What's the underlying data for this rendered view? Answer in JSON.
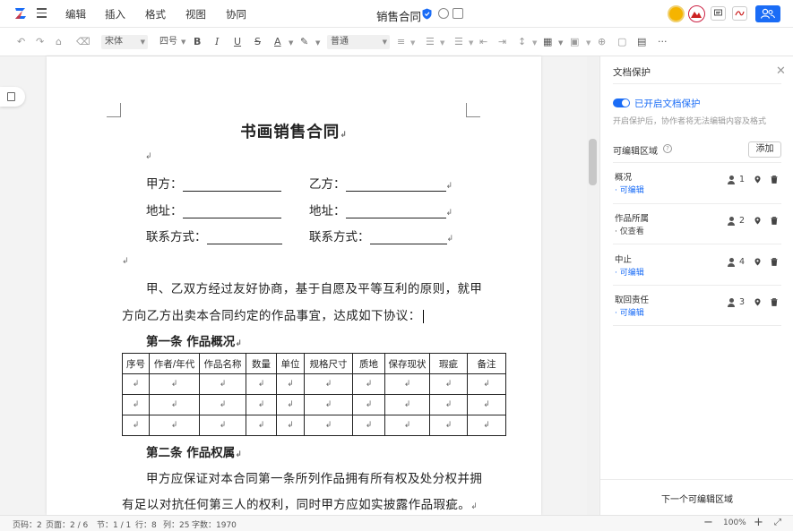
{
  "topbar": {
    "menus": [
      "编辑",
      "插入",
      "格式",
      "视图",
      "协同"
    ],
    "title": "销售合同"
  },
  "toolbar": {
    "font": "宋体",
    "size": "四号",
    "bold": "B",
    "italic": "I",
    "underline": "U",
    "strike": "S",
    "font_color": "A",
    "style": "普通",
    "more": "···"
  },
  "document": {
    "heading": "书画销售合同",
    "party_a": "甲方：",
    "party_b": "乙方：",
    "address_a": "地址：",
    "address_b": "地址：",
    "contact_a": "联系方式：",
    "contact_b": "联系方式：",
    "intro_line1": "甲、乙双方经过友好协商，基于自愿及平等互利的原则，就甲",
    "intro_line2": "方向乙方出卖本合同约定的作品事宜，达成如下协议：",
    "section1": "第一条  作品概况",
    "table_headers": [
      "序号",
      "作者/年代",
      "作品名称",
      "数量",
      "单位",
      "规格尺寸",
      "质地",
      "保存现状",
      "瑕疵",
      "备注"
    ],
    "section2": "第二条  作品权属",
    "body2_line1": "甲方应保证对本合同第一条所列作品拥有所有权及处分权并拥",
    "body2_line2": "有足以对抗任何第三人的权利，同时甲方应如实披露作品瑕疵。",
    "para_mark": "↲"
  },
  "panel": {
    "title": "文档保护",
    "toggle_label": "已开启文档保护",
    "description": "开启保护后，协作者将无法编辑内容及格式",
    "editable_regions_label": "可编辑区域",
    "add_button": "添加",
    "regions": [
      {
        "name": "概况",
        "permission": "· 可编辑",
        "count": "1"
      },
      {
        "name": "作品所属",
        "permission": "· 仅查看",
        "count": "2"
      },
      {
        "name": "中止",
        "permission": "· 可编辑",
        "count": "4"
      },
      {
        "name": "取回责任",
        "permission": "· 可编辑",
        "count": "3"
      }
    ],
    "next_region": "下一个可编辑区域"
  },
  "status": {
    "page_number": "页码：2",
    "pages": "页面：2 / 6",
    "section": "节：1 / 1",
    "row": "行：8",
    "column": "列：25",
    "word_count": "字数：1970",
    "zoom": "100%"
  },
  "colors": {
    "accent": "#1a6cf6",
    "toggle_on": "#1a6cf6"
  }
}
